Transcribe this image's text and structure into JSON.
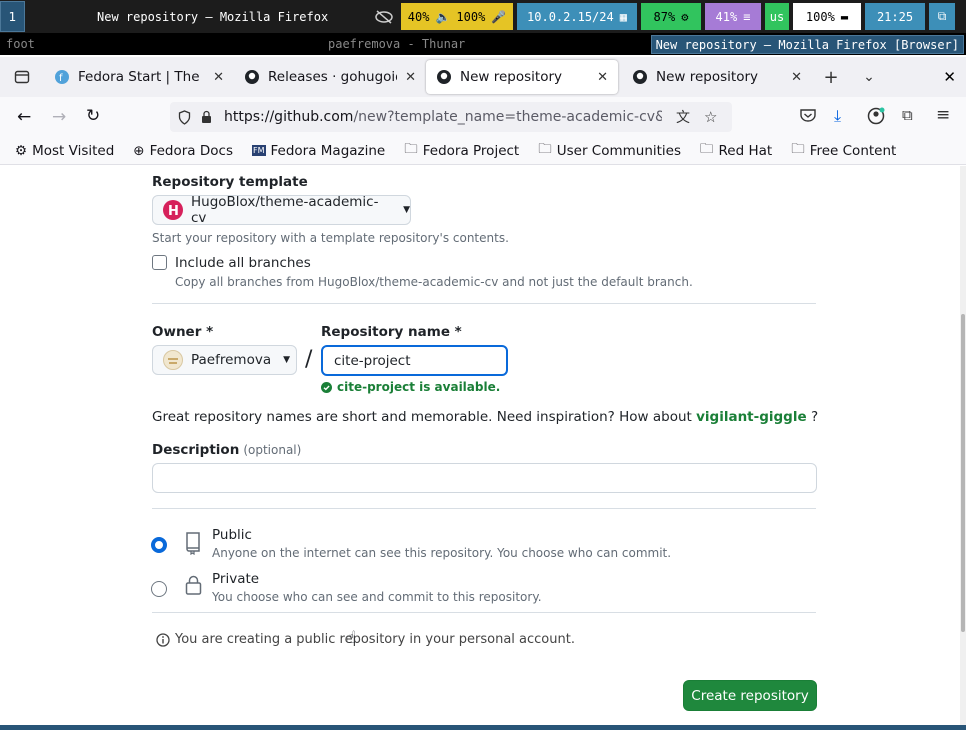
{
  "sysbar": {
    "workspace": "1",
    "window_title": "New repository — Mozilla Firefox",
    "audio": "40%",
    "mic": "100%",
    "ip": "10.0.2.15/24",
    "cpu": "87%",
    "mem": "41%",
    "kbd": "us",
    "battery": "100%",
    "time": "21:25"
  },
  "footbar": {
    "left": "foot",
    "center": "paefremova - Thunar",
    "right": "New repository — Mozilla Firefox [Browser]"
  },
  "tabs": [
    {
      "label": "Fedora Start | The Fedora"
    },
    {
      "label": "Releases · gohugoio/hugo"
    },
    {
      "label": "New repository"
    },
    {
      "label": "New repository"
    }
  ],
  "url": {
    "host": "https://github.com",
    "path": "/new?template_name=theme-academic-cv&template_owner=HugoBlox"
  },
  "bookmarks": [
    "Most Visited",
    "Fedora Docs",
    "Fedora Magazine",
    "Fedora Project",
    "User Communities",
    "Red Hat",
    "Free Content"
  ],
  "form": {
    "template_label": "Repository template",
    "template_value": "HugoBlox/theme-academic-cv",
    "template_hint": "Start your repository with a template repository's contents.",
    "include_branches_label": "Include all branches",
    "include_branches_hint": "Copy all branches from HugoBlox/theme-academic-cv and not just the default branch.",
    "owner_label": "Owner *",
    "owner_value": "Paefremova",
    "slash": "/",
    "repo_label": "Repository name *",
    "repo_value": "cite-project",
    "available": "cite-project is available.",
    "inspiration": "Great repository names are short and memorable. Need inspiration? How about",
    "suggestion": "vigilant-giggle",
    "suggestion_end": "?",
    "description_label": "Description",
    "optional": "(optional)",
    "public_label": "Public",
    "public_hint": "Anyone on the internet can see this repository. You choose who can commit.",
    "private_label": "Private",
    "private_hint": "You choose who can see and commit to this repository.",
    "info": "You are creating a public repository in your personal account.",
    "create_button": "Create repository"
  },
  "colors": {
    "accent": "#1f883d",
    "focus": "#0969da",
    "link": "#1a7f37",
    "template_badge": "#d6215b"
  }
}
